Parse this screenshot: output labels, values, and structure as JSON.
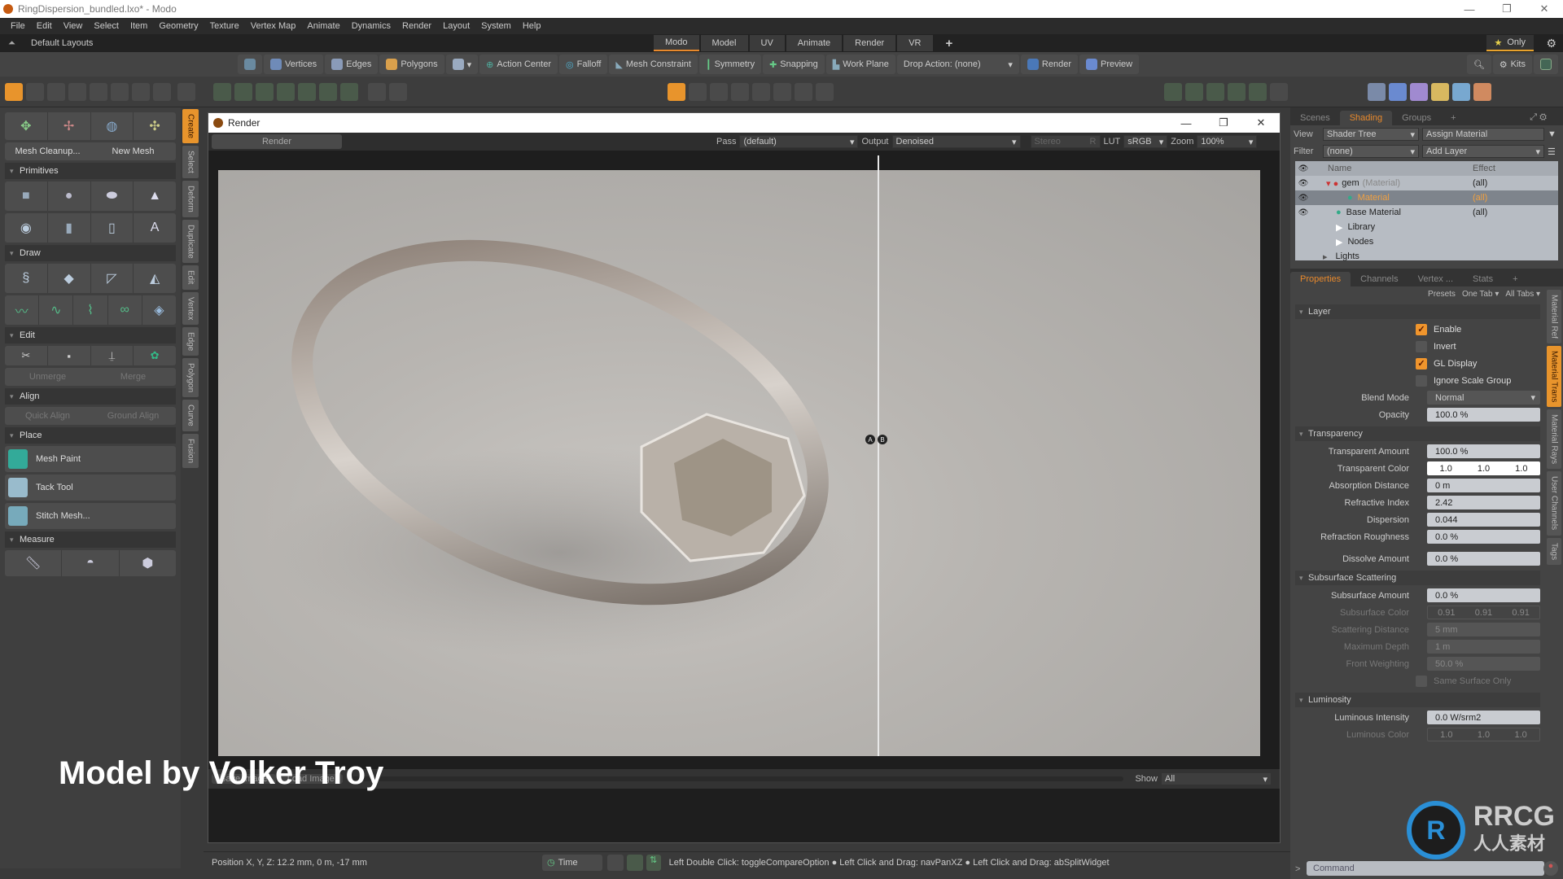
{
  "window": {
    "title": "RingDispersion_bundled.lxo* - Modo",
    "minimize": "—",
    "maximize": "❐",
    "close": "✕"
  },
  "menu": [
    "File",
    "Edit",
    "View",
    "Select",
    "Item",
    "Geometry",
    "Texture",
    "Vertex Map",
    "Animate",
    "Dynamics",
    "Render",
    "Layout",
    "System",
    "Help"
  ],
  "layout_bar": {
    "label": "Default Layouts",
    "tabs": [
      "Modo",
      "Model",
      "UV",
      "Animate",
      "Render",
      "VR"
    ],
    "active_tab": "Modo",
    "add": "+",
    "only_label": "Only"
  },
  "toolbar": {
    "selection_modes": [
      "Vertices",
      "Edges",
      "Polygons"
    ],
    "tools": [
      "Action Center",
      "Falloff",
      "Mesh Constraint",
      "Symmetry",
      "Snapping",
      "Work Plane"
    ],
    "drop_action": "Drop Action: (none)",
    "render": "Render",
    "preview": "Preview",
    "kits": "Kits"
  },
  "left_panel": {
    "buttons": {
      "mesh_cleanup": "Mesh Cleanup...",
      "new_mesh": "New Mesh",
      "unmerge": "Unmerge",
      "merge": "Merge",
      "quick_align": "Quick Align",
      "ground_align": "Ground Align"
    },
    "sections": {
      "primitives": "Primitives",
      "draw": "Draw",
      "edit": "Edit",
      "align": "Align",
      "place": "Place",
      "measure": "Measure"
    },
    "place_items": [
      "Mesh Paint",
      "Tack Tool",
      "Stitch Mesh..."
    ],
    "vertical_tabs": [
      "Create",
      "Select",
      "Deform",
      "Duplicate",
      "Edit",
      "Vertex",
      "Edge",
      "Polygon",
      "Curve",
      "Fusion"
    ],
    "active_vtab": "Create"
  },
  "render_window": {
    "title": "Render",
    "render_button": "Render",
    "pass_label": "Pass",
    "pass_value": "(default)",
    "output_label": "Output",
    "output_value": "Denoised",
    "stereo_label": "Stereo",
    "stereo_value": "R",
    "lut_label": "LUT",
    "lut_value": "sRGB",
    "zoom_label": "Zoom",
    "zoom_value": "100%",
    "compare_a": "A",
    "compare_b": "B",
    "save_image": "Save Image",
    "load_image": "Load Image",
    "show_label": "Show",
    "show_value": "All"
  },
  "caption": "Model by Volker Troy",
  "status": {
    "position": "Position X, Y, Z:   12.2 mm, 0 m, -17 mm",
    "time": "Time",
    "hint": "Left Double Click: toggleCompareOption ● Left Click and Drag: navPanXZ ● Left Click and Drag: abSplitWidget"
  },
  "shading_panel": {
    "tabs": [
      "Scenes",
      "Shading",
      "Groups",
      "+"
    ],
    "active_tab": "Shading",
    "view_label": "View",
    "view_value": "Shader Tree",
    "assign_material": "Assign Material",
    "filter_label": "Filter",
    "filter_value": "(none)",
    "add_layer": "Add Layer",
    "col_name": "Name",
    "col_effect": "Effect",
    "rows": [
      {
        "name": "gem",
        "suffix": "(Material)",
        "effect": "(all)"
      },
      {
        "name": "Material",
        "suffix": "",
        "effect": "(all)"
      },
      {
        "name": "Base Material",
        "suffix": "",
        "effect": "(all)"
      },
      {
        "name": "Library",
        "suffix": "",
        "effect": ""
      },
      {
        "name": "Nodes",
        "suffix": "",
        "effect": ""
      },
      {
        "name": "Lights",
        "suffix": "",
        "effect": ""
      }
    ]
  },
  "properties_panel": {
    "tabs": [
      "Properties",
      "Channels",
      "Vertex ...",
      "Stats",
      "+"
    ],
    "active_tab": "Properties",
    "presets": "Presets",
    "one_tab": "One Tab ▾",
    "all_tabs": "All Tabs ▾",
    "layer": {
      "title": "Layer",
      "checks": [
        {
          "label": "Enable",
          "checked": true
        },
        {
          "label": "Invert",
          "checked": false
        },
        {
          "label": "GL Display",
          "checked": true
        },
        {
          "label": "Ignore Scale Group",
          "checked": false
        }
      ],
      "blend_mode_label": "Blend Mode",
      "blend_mode": "Normal",
      "opacity_label": "Opacity",
      "opacity": "100.0 %"
    },
    "transparency": {
      "title": "Transparency",
      "fields": [
        {
          "label": "Transparent Amount",
          "value": "100.0 %"
        },
        {
          "label": "Transparent Color",
          "value": [
            "1.0",
            "1.0",
            "1.0"
          ]
        },
        {
          "label": "Absorption Distance",
          "value": "0 m"
        },
        {
          "label": "Refractive Index",
          "value": "2.42"
        },
        {
          "label": "Dispersion",
          "value": "0.044"
        },
        {
          "label": "Refraction Roughness",
          "value": "0.0 %"
        }
      ],
      "dissolve_label": "Dissolve Amount",
      "dissolve": "0.0 %"
    },
    "subsurface": {
      "title": "Subsurface Scattering",
      "amount_label": "Subsurface Amount",
      "amount": "0.0 %",
      "color_label": "Subsurface Color",
      "color": [
        "0.91",
        "0.91",
        "0.91"
      ],
      "distance_label": "Scattering Distance",
      "distance": "5 mm",
      "depth_label": "Maximum Depth",
      "depth": "1 m",
      "weight_label": "Front Weighting",
      "weight": "50.0 %",
      "same_surface": "Same Surface Only"
    },
    "luminosity": {
      "title": "Luminosity",
      "intensity_label": "Luminous Intensity",
      "intensity": "0.0 W/srm2",
      "color_label": "Luminous Color",
      "color": [
        "1.0",
        "1.0",
        "1.0"
      ]
    },
    "vertical_tabs": [
      "Material Ref",
      "Material Trans",
      "Material Rays",
      "User Channels",
      "Tags"
    ],
    "active_vtab": "Material Trans"
  },
  "command_placeholder": "Command",
  "watermark": {
    "brand": "RRCG",
    "sub": "人人素材"
  },
  "colors": {
    "accent": "#e8892c",
    "shader_bg": "#b7bcc3",
    "field_bg": "#c9ccd1"
  }
}
